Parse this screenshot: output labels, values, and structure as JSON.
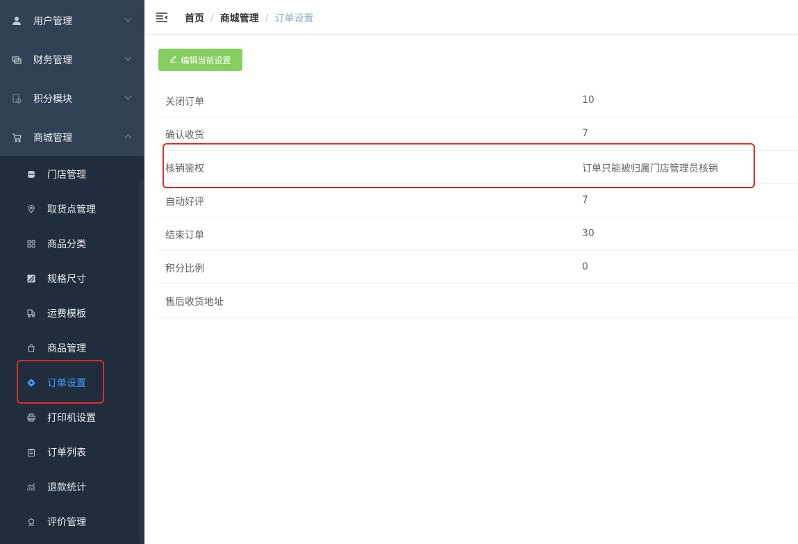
{
  "sidebar": {
    "menus": [
      {
        "label": "用户管理",
        "icon": "user-icon"
      },
      {
        "label": "财务管理",
        "icon": "money-icon"
      },
      {
        "label": "积分模块",
        "icon": "points-icon"
      },
      {
        "label": "商城管理",
        "icon": "cart-icon"
      }
    ],
    "submenu": [
      {
        "label": "门店管理",
        "icon": "store-icon"
      },
      {
        "label": "取货点管理",
        "icon": "location-icon"
      },
      {
        "label": "商品分类",
        "icon": "grid-icon"
      },
      {
        "label": "规格尺寸",
        "icon": "size-icon"
      },
      {
        "label": "运费模板",
        "icon": "truck-icon"
      },
      {
        "label": "商品管理",
        "icon": "bag-icon"
      },
      {
        "label": "订单设置",
        "icon": "gear-icon"
      },
      {
        "label": "打印机设置",
        "icon": "printer-icon"
      },
      {
        "label": "订单列表",
        "icon": "list-icon"
      },
      {
        "label": "退款统计",
        "icon": "chart-icon"
      },
      {
        "label": "评价管理",
        "icon": "comment-icon"
      }
    ]
  },
  "header": {
    "breadcrumb": [
      "首页",
      "商城管理",
      "订单设置"
    ]
  },
  "main": {
    "edit_button": "编辑当前设置",
    "rows": [
      {
        "key": "关闭订单",
        "value": "10"
      },
      {
        "key": "确认收货",
        "value": "7"
      },
      {
        "key": "核销鉴权",
        "value": "订单只能被归属门店管理员核销"
      },
      {
        "key": "自动好评",
        "value": "7"
      },
      {
        "key": "结束订单",
        "value": "30"
      },
      {
        "key": "积分比例",
        "value": "0"
      },
      {
        "key": "售后收货地址",
        "value": ""
      }
    ]
  },
  "colors": {
    "sidebar_bg": "#304156",
    "submenu_bg": "#1f2d3d",
    "active": "#409eff",
    "button": "#85ce61",
    "highlight": "#e02b20"
  }
}
